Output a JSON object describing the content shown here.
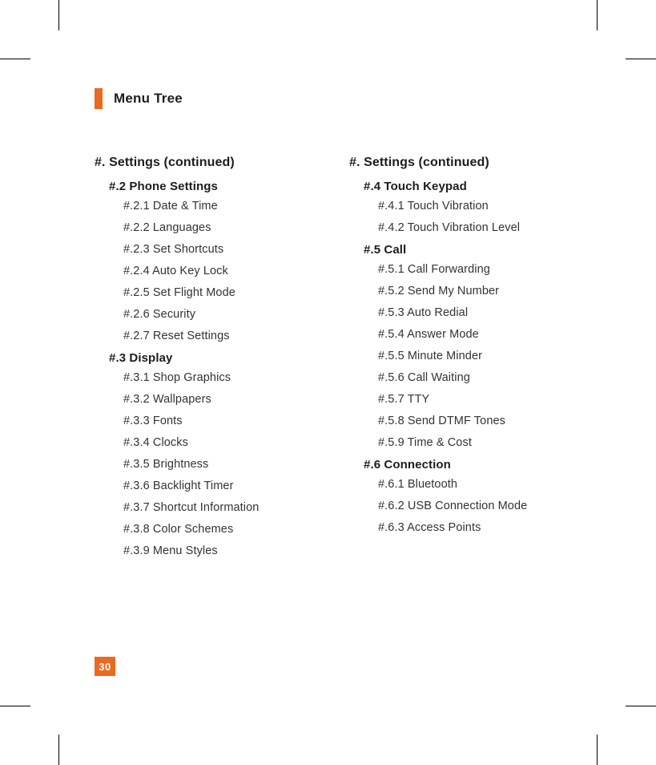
{
  "section_title": "Menu Tree",
  "page_number": "30",
  "left": {
    "heading": "#. Settings (continued)",
    "groups": [
      {
        "title": "#.2 Phone Settings",
        "items": [
          "#.2.1 Date & Time",
          "#.2.2 Languages",
          "#.2.3 Set Shortcuts",
          "#.2.4 Auto Key Lock",
          "#.2.5 Set Flight Mode",
          "#.2.6 Security",
          "#.2.7 Reset Settings"
        ]
      },
      {
        "title": "#.3 Display",
        "items": [
          "#.3.1 Shop Graphics",
          "#.3.2 Wallpapers",
          "#.3.3 Fonts",
          "#.3.4 Clocks",
          "#.3.5 Brightness",
          "#.3.6 Backlight Timer",
          "#.3.7 Shortcut Information",
          "#.3.8 Color Schemes",
          "#.3.9 Menu Styles"
        ]
      }
    ]
  },
  "right": {
    "heading": "#. Settings (continued)",
    "groups": [
      {
        "title": "#.4 Touch Keypad",
        "items": [
          "#.4.1 Touch Vibration",
          "#.4.2 Touch Vibration Level"
        ]
      },
      {
        "title": "#.5 Call",
        "items": [
          "#.5.1 Call Forwarding",
          "#.5.2 Send My Number",
          "#.5.3 Auto Redial",
          "#.5.4 Answer Mode",
          "#.5.5 Minute Minder",
          "#.5.6 Call Waiting",
          "#.5.7 TTY",
          "#.5.8 Send DTMF Tones",
          "#.5.9 Time & Cost"
        ]
      },
      {
        "title": "#.6 Connection",
        "items": [
          "#.6.1 Bluetooth",
          "#.6.2 USB Connection Mode",
          "#.6.3 Access Points"
        ]
      }
    ]
  }
}
